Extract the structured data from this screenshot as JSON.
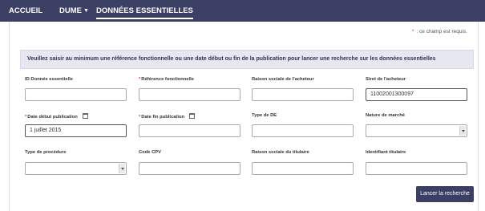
{
  "nav": {
    "items": [
      {
        "label": "ACCUEIL"
      },
      {
        "label": "DUME"
      },
      {
        "label": "DONNÉES ESSENTIELLES"
      }
    ]
  },
  "form": {
    "required_note": ": ce champ est requis.",
    "banner": "Veuillez saisir au minimum une référence fonctionnelle ou une date début ou fin de la publication pour lancer une recherche sur les données essentielles",
    "labels": {
      "id_donnee": "ID Donnée essentielle",
      "ref_fonctionnelle": "Référence fonctionnelle",
      "raison_acheteur": "Raison sociale de l'acheteur",
      "siret_acheteur": "Siret de l'acheteur",
      "date_debut": "Date début publication",
      "date_fin": "Date fin publication",
      "type_de": "Type de DE",
      "nature_marche": "Nature de marché",
      "type_procedure": "Type de procédure",
      "code_cpv": "Code CPV",
      "raison_titulaire": "Raison sociale du titulaire",
      "identifiant_titulaire": "Identifiant titulaire"
    },
    "values": {
      "siret_acheteur": "11002001300097",
      "date_debut": "1 juillet 2015"
    },
    "submit_label": "Lancer la recherche"
  },
  "colors": {
    "nav_bg": "#3a3f63",
    "banner_bg": "#e7e7f1",
    "required": "#e02d2d",
    "button_bg": "#3a3f63"
  },
  "icons": [
    "caret-down-icon",
    "calendar-icon",
    "select-arrow-icon"
  ]
}
